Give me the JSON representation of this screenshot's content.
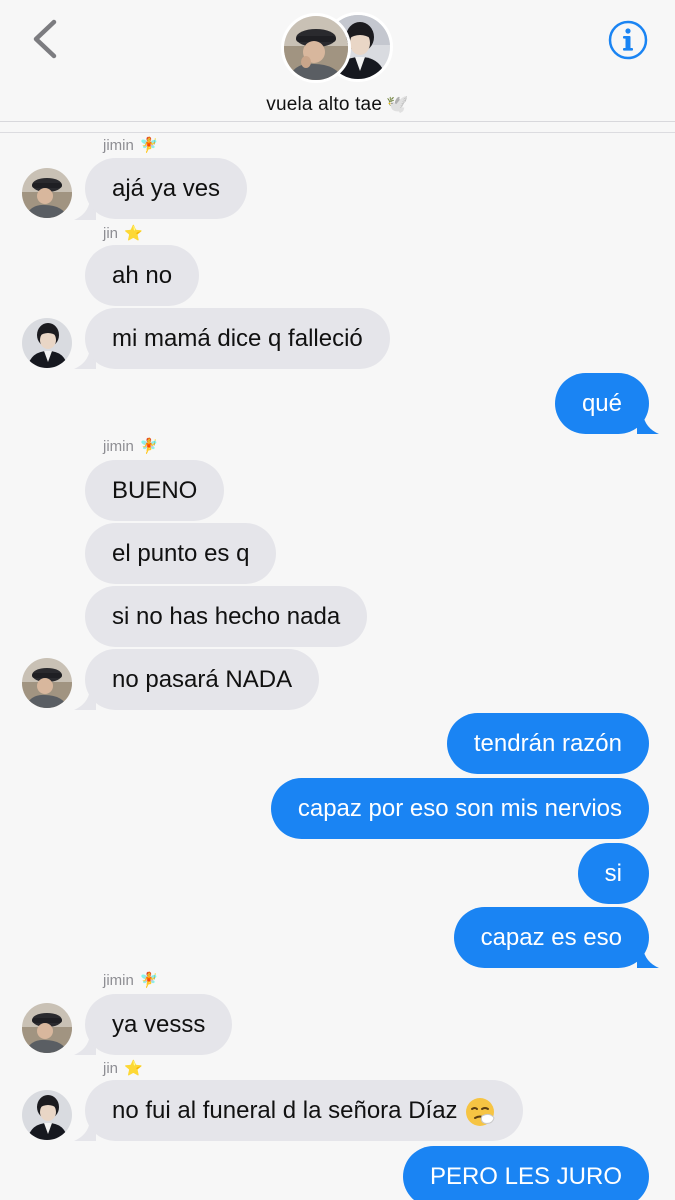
{
  "header": {
    "title": "vuela alto tae",
    "title_emoji": "🕊️",
    "back_icon": "chevron-left-icon",
    "info_icon": "info-icon"
  },
  "colors": {
    "accent": "#1a84f3",
    "incoming_bubble": "#e5e5ea",
    "background": "#f7f7f7",
    "sender_label": "#8e8e93"
  },
  "participants": {
    "jimin": {
      "name": "jimin",
      "emoji": "🧚"
    },
    "jin": {
      "name": "jin",
      "emoji": "⭐"
    }
  },
  "messages": [
    {
      "dir": "in",
      "sender": "jimin",
      "text": "ajá ya ves"
    },
    {
      "dir": "in",
      "sender": "jin",
      "text": "ah no"
    },
    {
      "dir": "in",
      "sender": "jin",
      "text": "mi mamá dice q falleció"
    },
    {
      "dir": "out",
      "text": "qué"
    },
    {
      "dir": "in",
      "sender": "jimin",
      "text": "BUENO"
    },
    {
      "dir": "in",
      "sender": "jimin",
      "text": "el punto es q"
    },
    {
      "dir": "in",
      "sender": "jimin",
      "text": "si no has hecho nada"
    },
    {
      "dir": "in",
      "sender": "jimin",
      "text": "no pasará NADA"
    },
    {
      "dir": "out",
      "text": "tendrán razón"
    },
    {
      "dir": "out",
      "text": "capaz por eso son mis nervios"
    },
    {
      "dir": "out",
      "text": "si"
    },
    {
      "dir": "out",
      "text": "capaz es eso"
    },
    {
      "dir": "in",
      "sender": "jimin",
      "text": "ya vesss"
    },
    {
      "dir": "in",
      "sender": "jin",
      "text": "no fui al funeral d la señora Díaz",
      "emoji": "sneezing-face-icon"
    },
    {
      "dir": "out",
      "text": "PERO LES JURO"
    }
  ]
}
